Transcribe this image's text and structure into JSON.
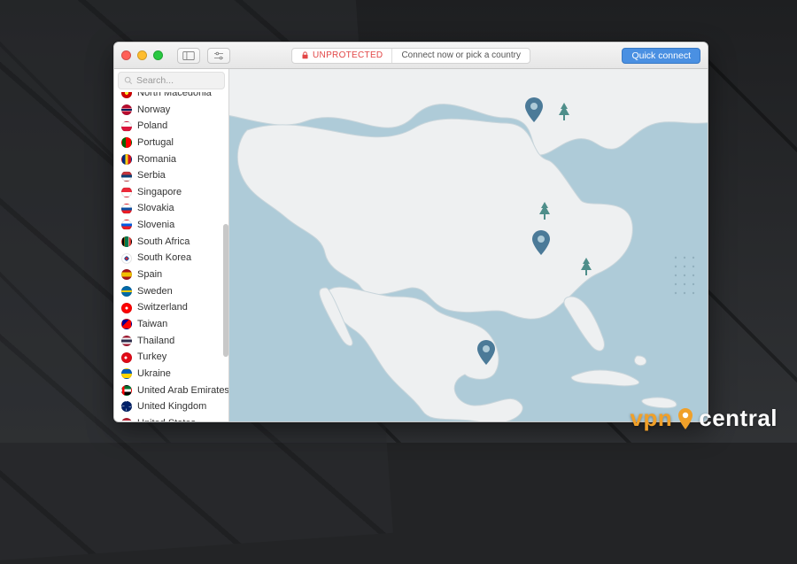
{
  "titlebar": {
    "status_label": "UNPROTECTED",
    "status_message": "Connect now or pick a country",
    "quick_connect_label": "Quick connect"
  },
  "sidebar": {
    "search_placeholder": "Search...",
    "countries": [
      {
        "name": "North Macedonia",
        "flag": "mk"
      },
      {
        "name": "Norway",
        "flag": "no"
      },
      {
        "name": "Poland",
        "flag": "pl"
      },
      {
        "name": "Portugal",
        "flag": "pt"
      },
      {
        "name": "Romania",
        "flag": "ro"
      },
      {
        "name": "Serbia",
        "flag": "rs"
      },
      {
        "name": "Singapore",
        "flag": "sg"
      },
      {
        "name": "Slovakia",
        "flag": "sk"
      },
      {
        "name": "Slovenia",
        "flag": "si"
      },
      {
        "name": "South Africa",
        "flag": "za"
      },
      {
        "name": "South Korea",
        "flag": "kr"
      },
      {
        "name": "Spain",
        "flag": "es"
      },
      {
        "name": "Sweden",
        "flag": "se"
      },
      {
        "name": "Switzerland",
        "flag": "ch"
      },
      {
        "name": "Taiwan",
        "flag": "tw"
      },
      {
        "name": "Thailand",
        "flag": "th"
      },
      {
        "name": "Turkey",
        "flag": "tr"
      },
      {
        "name": "Ukraine",
        "flag": "ua"
      },
      {
        "name": "United Arab Emirates",
        "flag": "ae"
      },
      {
        "name": "United Kingdom",
        "flag": "gb"
      },
      {
        "name": "United States",
        "flag": "us"
      }
    ]
  },
  "watermark": {
    "brand_a": "vpn",
    "brand_b": "central"
  },
  "colors": {
    "accent": "#4a90e2",
    "danger": "#e24646",
    "water": "#aecbd8",
    "land": "#eef0f1",
    "pin": "#4b7a98",
    "tree": "#4e8e8a"
  }
}
